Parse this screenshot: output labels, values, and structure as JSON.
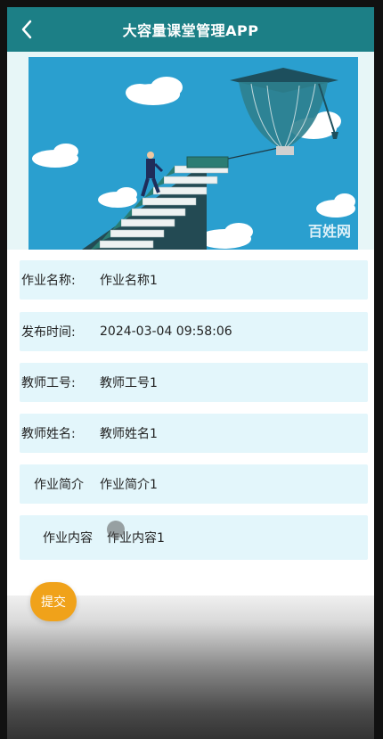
{
  "app": {
    "title": "大容量课堂管理APP"
  },
  "banner": {
    "watermark": "百姓网"
  },
  "fields": [
    {
      "label": "作业名称:",
      "value": "作业名称1"
    },
    {
      "label": "发布时间:",
      "value": "2024-03-04 09:58:06"
    },
    {
      "label": "教师工号:",
      "value": "教师工号1"
    },
    {
      "label": "教师姓名:",
      "value": "教师姓名1"
    },
    {
      "label": "作业简介",
      "value": "作业简介1"
    },
    {
      "label": "作业内容",
      "value": "作业内容1"
    }
  ],
  "actions": {
    "submit_label": "提交"
  },
  "colors": {
    "header": "#1c7f86",
    "field_bg": "#e3f6fb",
    "submit": "#f0a21a",
    "banner_sky": "#2a9fcf"
  },
  "icons": {
    "back": "chevron-left-icon"
  }
}
